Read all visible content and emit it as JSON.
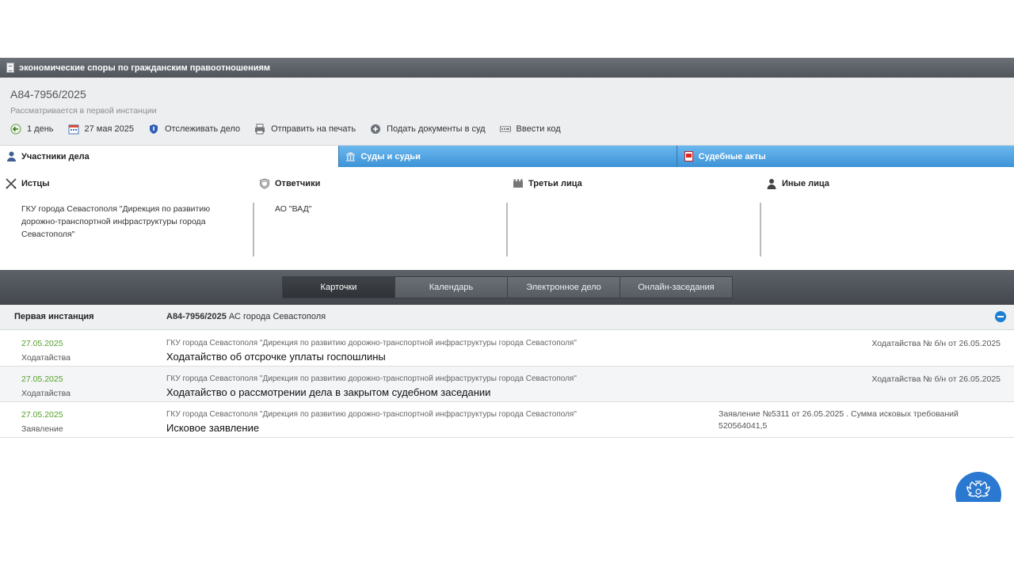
{
  "titlebar": {
    "title": "экономические споры по гражданским правоотношениям"
  },
  "case": {
    "number": "А84-7956/2025",
    "status": "Рассматривается в первой инстанции",
    "toolbar": {
      "days": "1 день",
      "date": "27 мая 2025",
      "track": "Отслеживать дело",
      "print": "Отправить на печать",
      "submit": "Подать документы в суд",
      "code": "Ввести код"
    }
  },
  "ptabs": {
    "participants": "Участники дела",
    "courts": "Суды и судьи",
    "acts": "Судебные акты"
  },
  "participants": {
    "plaintiffs": {
      "label": "Истцы",
      "value": "ГКУ города Севастополя \"Дирекция по развитию дорожно-транспортной инфраструктуры города Севастополя\""
    },
    "defendants": {
      "label": "Ответчики",
      "value": "АО \"ВАД\""
    },
    "third": {
      "label": "Третьи лица",
      "value": ""
    },
    "others": {
      "label": "Иные лица",
      "value": ""
    }
  },
  "views": {
    "cards": "Карточки",
    "calendar": "Календарь",
    "edelo": "Электронное дело",
    "online": "Онлайн-заседания"
  },
  "instance": {
    "title": "Первая инстанция",
    "case_number": "А84-7956/2025",
    "court": "АС города Севастополя"
  },
  "rows": [
    {
      "date": "27.05.2025",
      "type": "Ходатайства",
      "org": "ГКУ города Севастополя \"Дирекция по развитию дорожно-транспортной инфраструктуры города Севастополя\"",
      "title": "Ходатайство об отсрочке уплаты госпошлины",
      "note": "Ходатайства № б/н от 26.05.2025"
    },
    {
      "date": "27.05.2025",
      "type": "Ходатайства",
      "org": "ГКУ города Севастополя \"Дирекция по развитию дорожно-транспортной инфраструктуры города Севастополя\"",
      "title": "Ходатайство о рассмотрении дела в закрытом судебном заседании",
      "note": "Ходатайства № б/н от 26.05.2025"
    },
    {
      "date": "27.05.2025",
      "type": "Заявление",
      "org": "ГКУ города Севастополя \"Дирекция по развитию дорожно-транспортной инфраструктуры города Севастополя\"",
      "title": "Исковое заявление",
      "note": "Заявление №5311 от 26.05.2025 . Сумма исковых требований 520564041,5"
    }
  ]
}
